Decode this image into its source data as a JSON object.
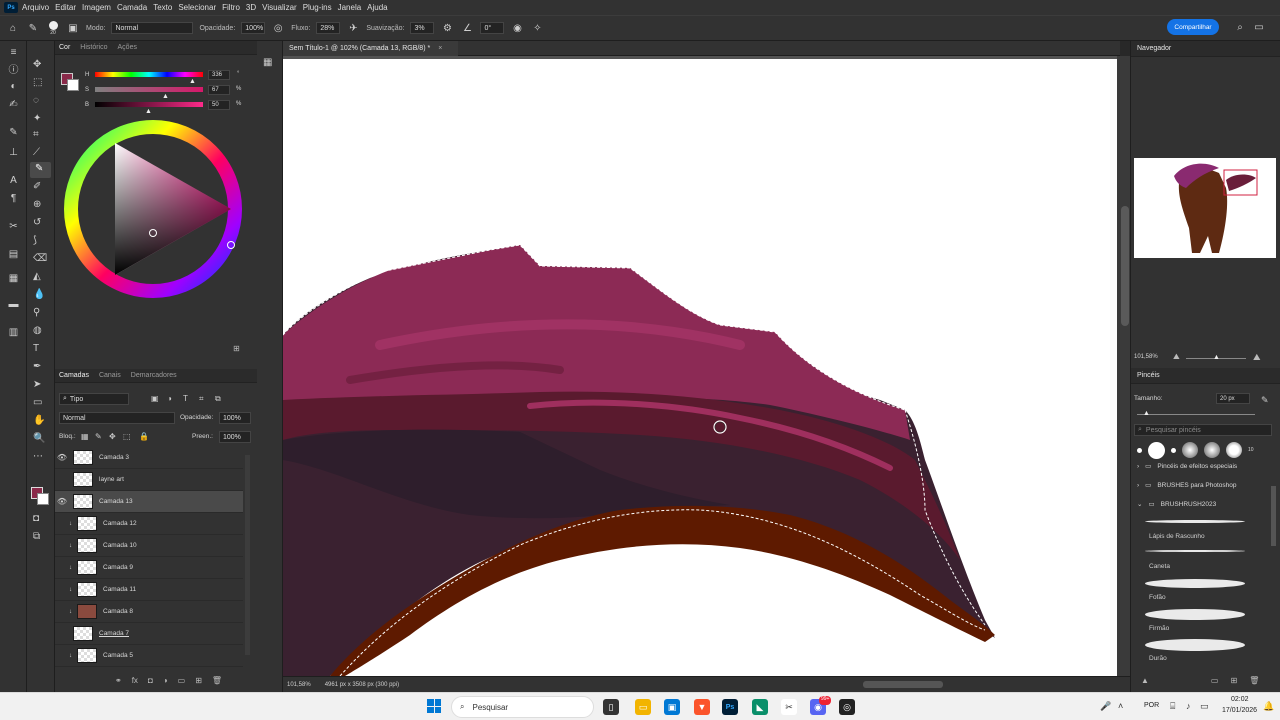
{
  "app": {
    "logo": "Ps"
  },
  "menu": [
    "Arquivo",
    "Editar",
    "Imagem",
    "Camada",
    "Texto",
    "Selecionar",
    "Filtro",
    "3D",
    "Visualizar",
    "Plug-ins",
    "Janela",
    "Ajuda"
  ],
  "options": {
    "brush_size": "20",
    "mode_label": "Modo:",
    "mode_value": "Normal",
    "opacity_label": "Opacidade:",
    "opacity_value": "100%",
    "flow_label": "Fluxo:",
    "flow_value": "28%",
    "smoothing_label": "Suavização:",
    "smoothing_value": "3%",
    "angle_value": "0°",
    "share_label": "Compartilhar"
  },
  "document": {
    "tab_title": "Sem Título-1 @ 102% (Camada 13, RGB/8) *",
    "close": "×",
    "zoom": "101,58%",
    "dimensions": "4961 px x 3508 px (300 ppi)"
  },
  "color_panel": {
    "tabs": [
      "Cor",
      "Histórico",
      "Ações"
    ],
    "h_label": "H",
    "h_value": "336",
    "h_unit": "°",
    "s_label": "S",
    "s_value": "67",
    "s_unit": "%",
    "b_label": "B",
    "b_value": "50",
    "b_unit": "%",
    "foreground": "#8a2a4a"
  },
  "layers_panel": {
    "tabs": [
      "Camadas",
      "Canais",
      "Demarcadores"
    ],
    "filter_kind": "Tipo",
    "blend_mode": "Normal",
    "opacity_label": "Opacidade:",
    "opacity_value": "100%",
    "lock_label": "Bloq.:",
    "fill_label": "Preen.:",
    "fill_value": "100%",
    "layers": [
      {
        "name": "Camada 3",
        "visible": true
      },
      {
        "name": "layne art",
        "visible": false
      },
      {
        "name": "Camada 13",
        "visible": true,
        "selected": true
      },
      {
        "name": "Camada 12",
        "visible": false,
        "clipped": true
      },
      {
        "name": "Camada 10",
        "visible": false,
        "clipped": true
      },
      {
        "name": "Camada 9",
        "visible": false,
        "clipped": true
      },
      {
        "name": "Camada 11",
        "visible": false,
        "clipped": true
      },
      {
        "name": "Camada 8",
        "visible": false,
        "clipped": true,
        "color": "#8a4a3e"
      },
      {
        "name": "Camada 7",
        "visible": false
      },
      {
        "name": "Camada 5",
        "visible": false,
        "clipped": true
      }
    ]
  },
  "navigator": {
    "title": "Navegador",
    "zoom": "101,58%"
  },
  "brushes": {
    "title": "Pincéis",
    "size_label": "Tamanho:",
    "size_value": "20 px",
    "search_placeholder": "Pesquisar pincéis",
    "preset_count": "10",
    "folders": [
      "Pincéis de efeitos especiais",
      "BRUSHES para Photoshop",
      "BRUSHRUSH2023"
    ],
    "items": [
      "Lápis de Rascunho",
      "Caneta",
      "Fofão",
      "Firmão",
      "Durão"
    ]
  },
  "taskbar": {
    "search_label": "Pesquisar",
    "lang": "POR",
    "time": "02:02",
    "date": "17/01/2026",
    "badge": "99+"
  }
}
